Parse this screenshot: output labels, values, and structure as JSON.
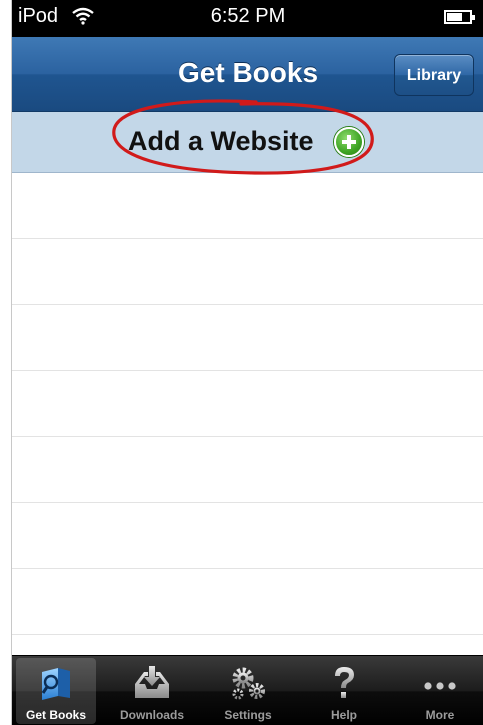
{
  "status_bar": {
    "carrier": "iPod",
    "time": "6:52 PM"
  },
  "nav_bar": {
    "title": "Get Books",
    "right_button": "Library"
  },
  "add_row": {
    "label": "Add a Website",
    "icon": "plus-circle-icon"
  },
  "list": {
    "empty_rows": 7
  },
  "tab_bar": {
    "tabs": [
      {
        "label": "Get Books",
        "icon": "book-icon",
        "selected": true
      },
      {
        "label": "Downloads",
        "icon": "download-tray-icon",
        "selected": false
      },
      {
        "label": "Settings",
        "icon": "gears-icon",
        "selected": false
      },
      {
        "label": "Help",
        "icon": "question-icon",
        "selected": false
      },
      {
        "label": "More",
        "icon": "more-dots-icon",
        "selected": false
      }
    ]
  },
  "colors": {
    "nav_blue": "#2b62a0",
    "add_row_bg": "#c3d7e8",
    "annotation_red": "#d11a1a",
    "add_icon_green": "#3ea424"
  }
}
